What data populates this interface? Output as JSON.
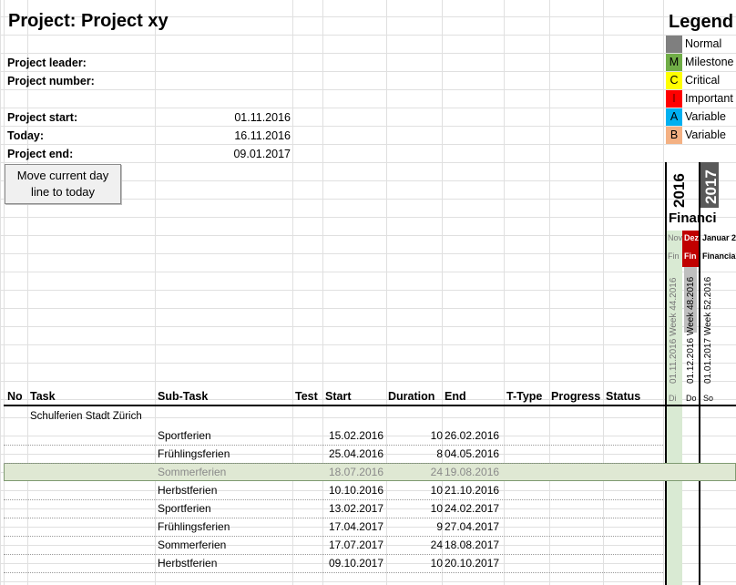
{
  "project": {
    "title": "Project: Project xy",
    "leader_label": "Project leader:",
    "number_label": "Project number:",
    "start_label": "Project start:",
    "start_value": "01.11.2016",
    "today_label": "Today:",
    "today_value": "16.11.2016",
    "end_label": "Project end:",
    "end_value": "09.01.2017"
  },
  "button": {
    "line1": "Move current day",
    "line2": "line to today"
  },
  "legend": {
    "title": "Legend",
    "items": [
      {
        "code": "",
        "label": "Normal",
        "color": "#7f7f7f"
      },
      {
        "code": "M",
        "label": "Milestone",
        "color": "#70ad47"
      },
      {
        "code": "C",
        "label": "Critical",
        "color": "#ffff00"
      },
      {
        "code": "I",
        "label": "Important",
        "color": "#ff0000"
      },
      {
        "code": "A",
        "label": "Variable",
        "color": "#00b0f0"
      },
      {
        "code": "B",
        "label": "Variable",
        "color": "#f4b183"
      }
    ]
  },
  "timeline": {
    "year1": "2016",
    "year2": "2017",
    "financial": "Financi",
    "months": [
      "Nov",
      "Dez",
      "Januar 2"
    ],
    "fin_row": [
      "Fin",
      "Fin",
      "Financia"
    ],
    "weeks": [
      "01.11.2016   Week 44.2016",
      "01.12.2016   Week 48.2016",
      "01.01.2017   Week 52.2016"
    ],
    "days": [
      "Di",
      "Do",
      "So"
    ],
    "colors": {
      "nov": "#d9ead3",
      "dez": "#c00000",
      "year2": "#595959"
    }
  },
  "table": {
    "headers": {
      "no": "No",
      "task": "Task",
      "subtask": "Sub-Task",
      "test": "Test",
      "start": "Start",
      "duration": "Duration",
      "end": "End",
      "ttype": "T-Type",
      "progress": "Progress",
      "status": "Status"
    },
    "group": "Schulferien Stadt Zürich",
    "rows": [
      {
        "sub": "Sportferien",
        "start": "15.02.2016",
        "dur": "10",
        "end": "26.02.2016"
      },
      {
        "sub": "Frühlingsferien",
        "start": "25.04.2016",
        "dur": "8",
        "end": "04.05.2016"
      },
      {
        "sub": "Sommerferien",
        "start": "18.07.2016",
        "dur": "24",
        "end": "19.08.2016"
      },
      {
        "sub": "Herbstferien",
        "start": "10.10.2016",
        "dur": "10",
        "end": "21.10.2016"
      },
      {
        "sub": "Sportferien",
        "start": "13.02.2017",
        "dur": "10",
        "end": "24.02.2017"
      },
      {
        "sub": "Frühlingsferien",
        "start": "17.04.2017",
        "dur": "9",
        "end": "27.04.2017"
      },
      {
        "sub": "Sommerferien",
        "start": "17.07.2017",
        "dur": "24",
        "end": "18.08.2017"
      },
      {
        "sub": "Herbstferien",
        "start": "09.10.2017",
        "dur": "10",
        "end": "20.10.2017"
      }
    ]
  }
}
